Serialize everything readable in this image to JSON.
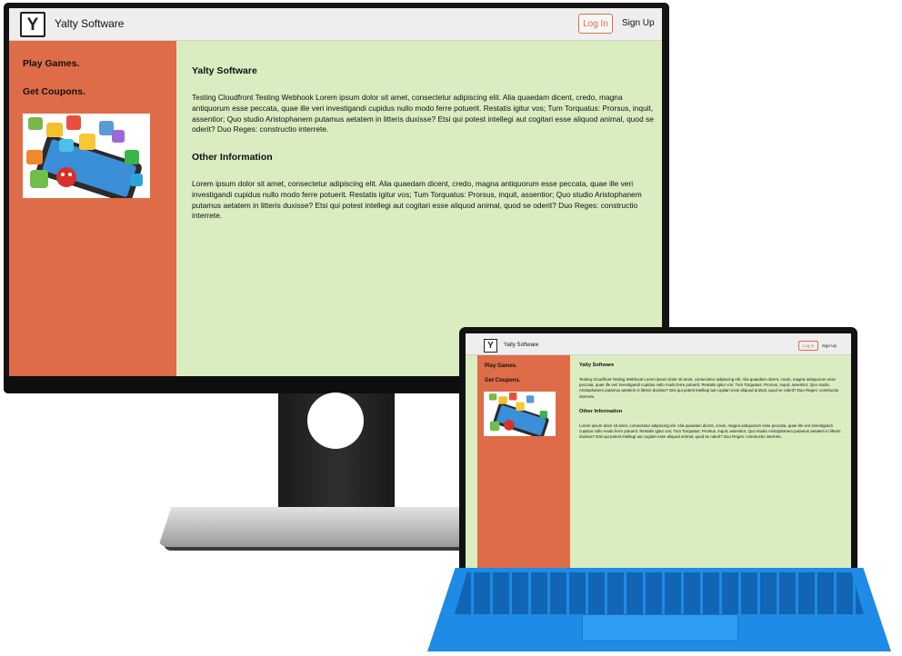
{
  "site": {
    "brand": "Yalty Software",
    "logo_letter": "Y",
    "nav": {
      "login": "Log In",
      "signup": "Sign Up"
    },
    "sidebar": {
      "links": [
        "Play Games.",
        "Get Coupons."
      ],
      "image": "app-icons-graphic"
    },
    "main": {
      "heading1": "Yalty Software",
      "para1": "Testing Cloudfront Testing Webhook Lorem ipsum dolor sit amet, consectetur adipiscing elit. Alia quaedam dicent, credo, magna antiquorum esse peccata, quae ille veri investigandi cupidus nullo modo ferre potuerit. Restatis igitur vos; Tum Torquatus: Prorsus, inquit, assentior; Quo studio Aristophanem putamus aetatem in litteris duxisse? Etsi qui potest intellegi aut cogitari esse aliquod animal, quod se oderit? Duo Reges: constructio interrete.",
      "heading2": "Other Information",
      "para2": "Lorem ipsum dolor sit amet, consectetur adipiscing elit. Alia quaedam dicent, credo, magna antiquorum esse peccata, quae ille veri investigandi cupidus nullo modo ferre potuerit. Restatis igitur vos; Tum Torquatus: Prorsus, inquit, assentior; Quo studio Aristophanem putamus aetatem in litteris duxisse? Etsi qui potest intellegi aut cogitari esse aliquod animal, quod se oderit? Duo Reges: constructio interrete."
    }
  },
  "colors": {
    "sidebar": "#df6c48",
    "content": "#d9edc0",
    "accent": "#d9714e",
    "keyboard": "#1e8be6"
  }
}
